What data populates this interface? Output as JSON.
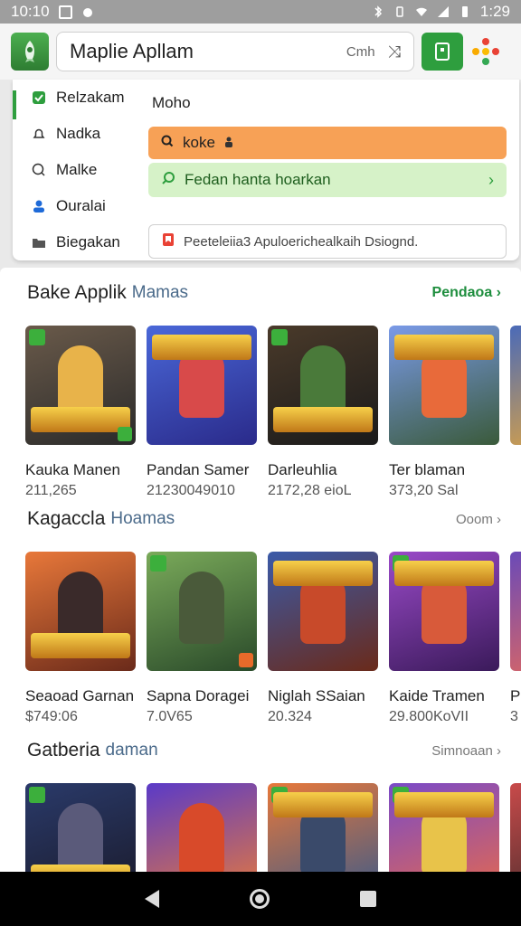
{
  "status_bar": {
    "time": "10:10",
    "right_time": "1:29"
  },
  "search": {
    "title": "Maplie Apllam",
    "aux_label": "Cmh"
  },
  "menu": [
    {
      "label": "Relzakam",
      "icon": "check-square-icon",
      "active": true
    },
    {
      "label": "Nadka",
      "icon": "bell-icon",
      "active": false
    },
    {
      "label": "Malke",
      "icon": "chat-icon",
      "active": false
    },
    {
      "label": "Ouralai",
      "icon": "person-icon",
      "active": false
    },
    {
      "label": "Biegakan",
      "icon": "folder-icon",
      "active": false
    }
  ],
  "suggestions": {
    "plain": "Moho",
    "orange": "koke",
    "green": "Fedan hanta hoarkan",
    "field": "Peeteleiia3 Apuloerichealkaih Dsiognd."
  },
  "sections": [
    {
      "title": "Bake Applik",
      "subtitle": "Mamas",
      "more": "Pendaoa",
      "more_green": true,
      "items": [
        {
          "name": "Kauka Manen",
          "meta": "211,265",
          "bg": "#5a4a3a",
          "accent": "#e8b34a"
        },
        {
          "name": "Pandan Samer",
          "meta": "21230049010",
          "bg": "#3b58c8",
          "accent": "#d84a4a"
        },
        {
          "name": "Darleuhlia",
          "meta": "2172,28 eioL",
          "bg": "#3a2e2a",
          "accent": "#4a7a3a"
        },
        {
          "name": "Ter blaman",
          "meta": "373,20 Sal",
          "bg": "#6a8ad8",
          "accent": "#e86a3a"
        },
        {
          "name": "",
          "meta": "",
          "bg": "#4a6ab8",
          "accent": "#e8a83a"
        }
      ]
    },
    {
      "title": "Kagaccla",
      "subtitle": "Hoamas",
      "more": "Ooom",
      "more_green": false,
      "items": [
        {
          "name": "Seaoad Garnan",
          "meta": "$749:06",
          "bg": "#c85a2a",
          "accent": "#3a2a2a"
        },
        {
          "name": "Sapna Doragei",
          "meta": "7.0V65",
          "bg": "#5a8a4a",
          "accent": "#4a5a3a"
        },
        {
          "name": "Niglah SSaian",
          "meta": "20.324",
          "bg": "#3a5aa8",
          "accent": "#c84a2a"
        },
        {
          "name": "Kaide Tramen",
          "meta": "29.800KoVII",
          "bg": "#8a3aa8",
          "accent": "#d85a3a"
        },
        {
          "name": "Pa",
          "meta": "3",
          "bg": "#6a4ab8",
          "accent": "#e86a5a"
        }
      ]
    },
    {
      "title": "Gatberia",
      "subtitle": "daman",
      "more": "Simnoaan",
      "more_green": false,
      "items": [
        {
          "name": "",
          "meta": "",
          "bg": "#2a3a6a",
          "accent": "#e8b34a"
        },
        {
          "name": "",
          "meta": "",
          "bg": "#5a3ac8",
          "accent": "#d84a2a"
        },
        {
          "name": "",
          "meta": "",
          "bg": "#3a5a8a",
          "accent": "#e8c34a"
        },
        {
          "name": "",
          "meta": "",
          "bg": "#7a4ac8",
          "accent": "#e86a4a"
        },
        {
          "name": "",
          "meta": "",
          "bg": "#c84a4a",
          "accent": "#3a2a2a"
        }
      ]
    }
  ],
  "colors": {
    "accent_green": "#2e9e3e",
    "orange": "#f7a156",
    "light_green": "#d6f2c8"
  }
}
